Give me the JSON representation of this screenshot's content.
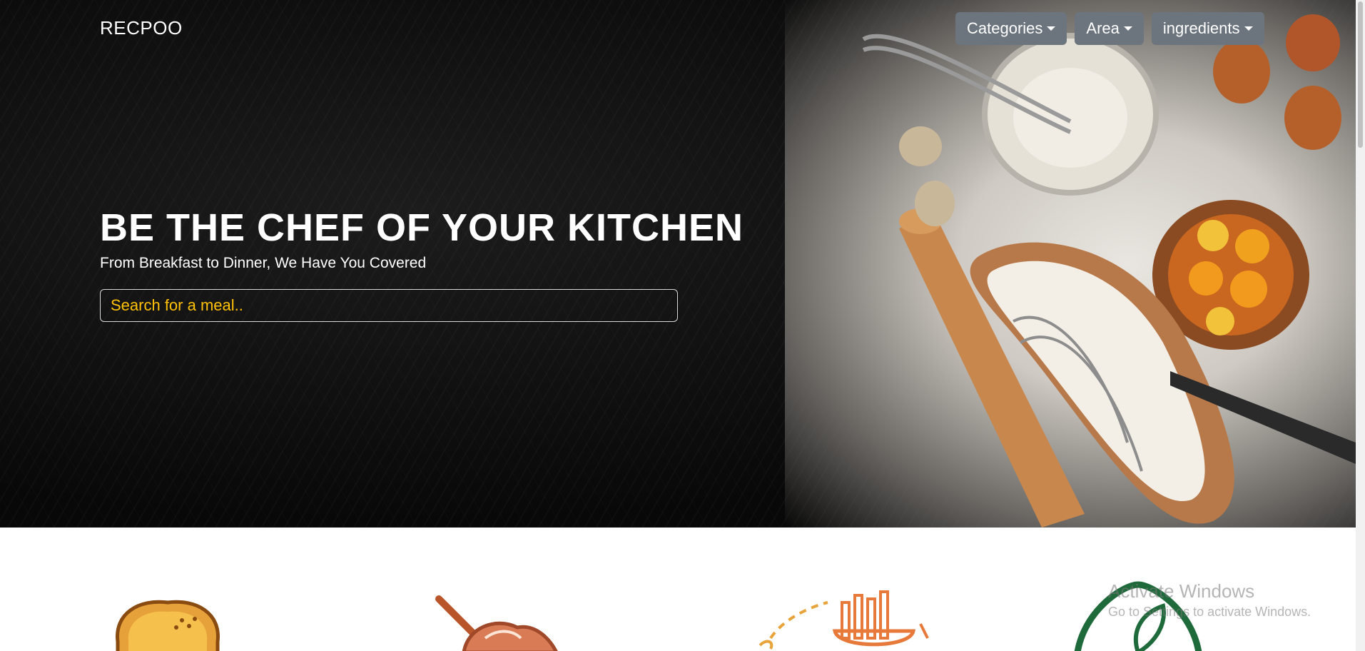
{
  "header": {
    "brand": "RECPOO",
    "nav": [
      {
        "label": "Categories"
      },
      {
        "label": "Area"
      },
      {
        "label": "ingredients"
      }
    ]
  },
  "hero": {
    "headline": "BE THE CHEF OF YOUR KITCHEN",
    "subline": "From Breakfast to Dinner, We Have You Covered",
    "search_placeholder": "Search for a meal.."
  },
  "categories": [
    {
      "icon": "bread-icon"
    },
    {
      "icon": "dessert-icon"
    },
    {
      "icon": "pasta-icon"
    },
    {
      "icon": "vegetarian-leaf-icon"
    }
  ],
  "watermark": {
    "title": "Activate Windows",
    "subtitle": "Go to Settings to activate Windows."
  },
  "colors": {
    "nav_button": "#6c757d",
    "accent": "#ffc107"
  }
}
